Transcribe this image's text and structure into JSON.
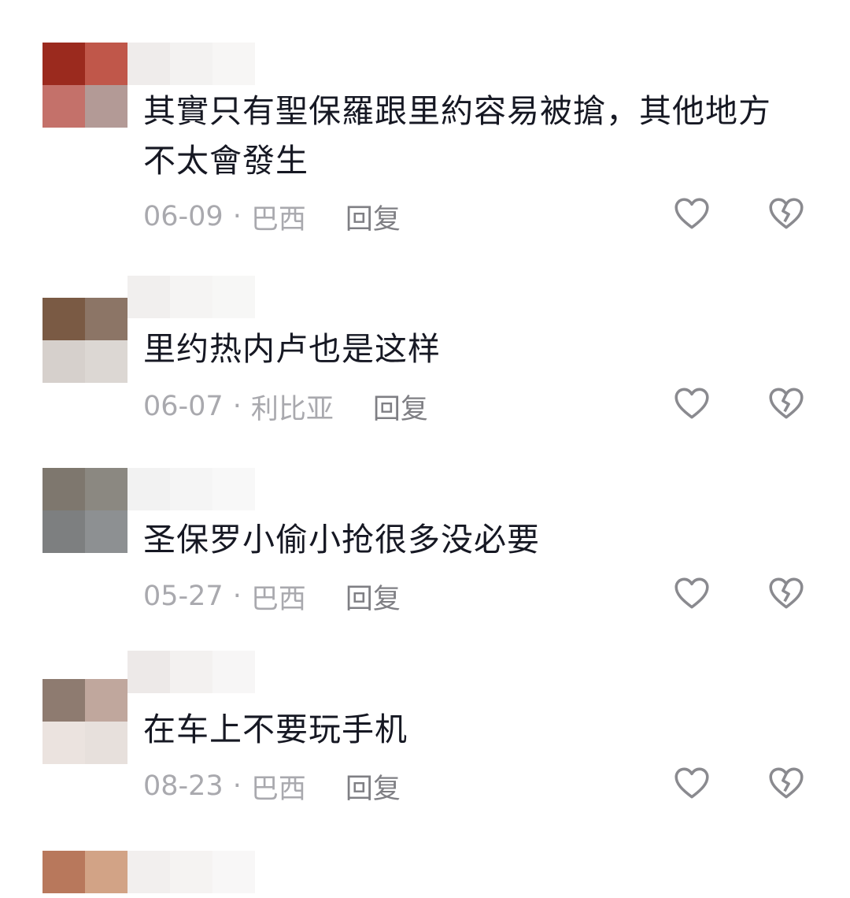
{
  "comments": [
    {
      "text": "其實只有聖保羅跟里約容易被搶，其他地方不太會發生",
      "date": "06-09",
      "location": "巴西",
      "reply_label": "回复",
      "avatar_colors": [
        "#9b2a1e",
        "#c0574a",
        "#c4716a",
        "#b39a96"
      ],
      "name_blur_colors": [
        "#efeceb",
        "#f3f2f1",
        "#f7f6f5"
      ]
    },
    {
      "text": "里约热内卢也是这样",
      "date": "06-07",
      "location": "利比亚",
      "reply_label": "回复",
      "avatar_colors": [
        "#7a5a44",
        "#8c7566",
        "#d6d0cc",
        "#dcd7d3"
      ],
      "name_blur_colors": [
        "#f1efee",
        "#f5f4f3",
        "#f7f7f6"
      ]
    },
    {
      "text": "圣保罗小偷小抢很多没必要",
      "date": "05-27",
      "location": "巴西",
      "reply_label": "回复",
      "avatar_colors": [
        "#7e776e",
        "#8b8881",
        "#7d7f80",
        "#8d9092"
      ],
      "name_blur_colors": [
        "#f2f2f2",
        "#f5f5f5",
        "#f8f8f8"
      ]
    },
    {
      "text": "在车上不要玩手机",
      "date": "08-23",
      "location": "巴西",
      "reply_label": "回复",
      "avatar_colors": [
        "#8e7b70",
        "#c0a79d",
        "#ebe3df",
        "#e7e0dc"
      ],
      "name_blur_colors": [
        "#ede9e8",
        "#f3f1f0",
        "#f7f6f6"
      ]
    },
    {
      "avatar_colors": [
        "#b8785c",
        "#d2a386",
        "#ffffff",
        "#ffffff"
      ],
      "name_blur_colors": [
        "#f2efee",
        "#f5f3f2",
        "#f8f7f7"
      ]
    }
  ],
  "icons": {
    "like": "heart-outline",
    "dislike": "broken-heart-outline"
  },
  "colors": {
    "text": "#161823",
    "meta": "#a9a9ae",
    "reply": "#7f7f84",
    "icon": "#8a8a8f"
  }
}
